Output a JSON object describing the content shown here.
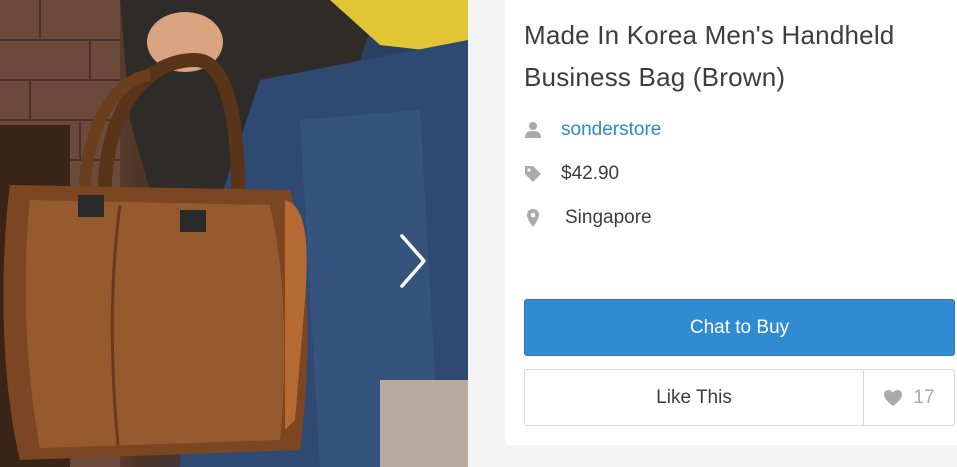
{
  "listing": {
    "title": "Made In Korea Men's Handheld Business Bag (Brown)",
    "seller": "sonderstore",
    "price": "$42.90",
    "location": "Singapore",
    "photo_description_icon": "leather-bag-photo"
  },
  "actions": {
    "chat_label": "Chat to Buy",
    "like_label": "Like This",
    "like_count": "17"
  },
  "icons": {
    "seller": "user-icon",
    "price": "tag-icon",
    "location": "map-pin-icon",
    "like": "heart-icon",
    "next": "chevron-right-icon"
  },
  "colors": {
    "link": "#2a8bcc",
    "primary_button": "#2f8bd2",
    "icon_gray": "#aaaaaa",
    "text": "#3d3d3d"
  }
}
